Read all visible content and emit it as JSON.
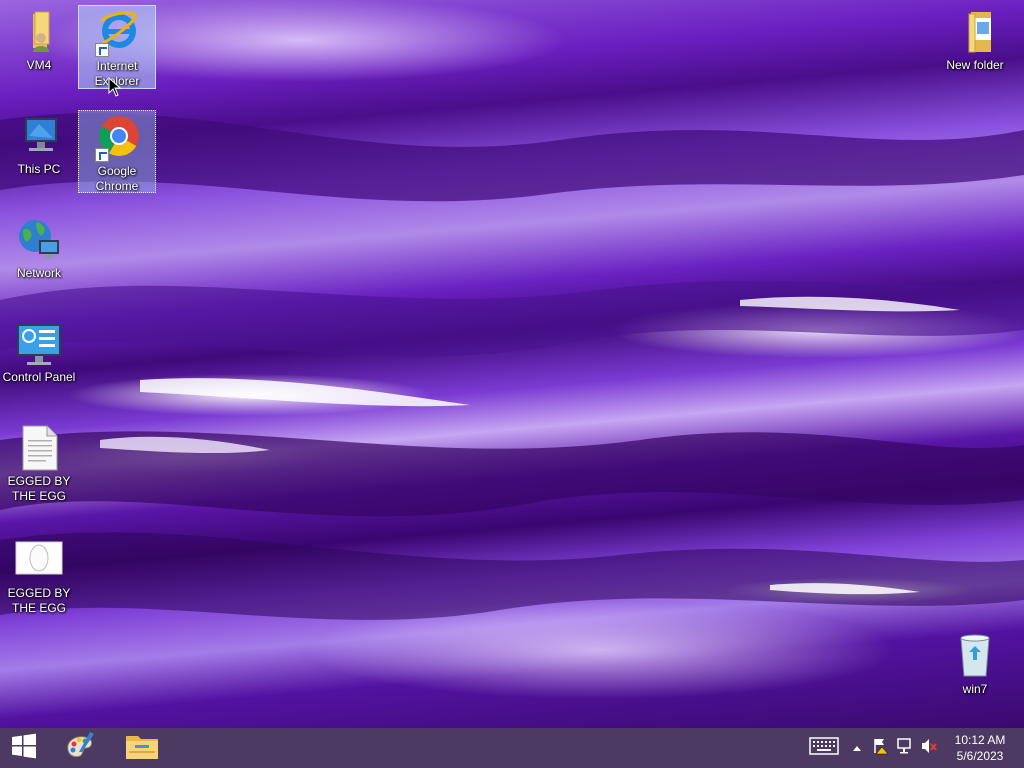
{
  "desktop": {
    "icons": [
      {
        "id": "vm4",
        "label": "VM4"
      },
      {
        "id": "internet-explorer",
        "label": "Internet Explorer"
      },
      {
        "id": "this-pc",
        "label": "This PC"
      },
      {
        "id": "google-chrome",
        "label": "Google Chrome"
      },
      {
        "id": "network",
        "label": "Network"
      },
      {
        "id": "control-panel",
        "label": "Control Panel"
      },
      {
        "id": "egged-file-1",
        "label": "EGGED BY THE EGG"
      },
      {
        "id": "egged-file-2",
        "label": "EGGED BY THE EGG"
      },
      {
        "id": "new-folder",
        "label": "New folder"
      },
      {
        "id": "recycle-bin",
        "label": "win7"
      }
    ]
  },
  "taskbar": {
    "start_icon": "windows-logo-icon",
    "pinned": [
      {
        "id": "paint",
        "icon": "paint-palette-icon"
      },
      {
        "id": "file-explorer",
        "icon": "file-explorer-icon"
      }
    ],
    "tray": {
      "icons": [
        "keyboard-icon",
        "show-hidden-icons-icon",
        "action-center-flag-icon",
        "network-icon",
        "volume-muted-icon"
      ]
    },
    "clock": {
      "time": "10:12 AM",
      "date": "5/6/2023"
    }
  },
  "colors": {
    "taskbar": "#4d3a62",
    "selection": "#b4d7fa",
    "wallpaper_primary": "#6a1fc0"
  }
}
